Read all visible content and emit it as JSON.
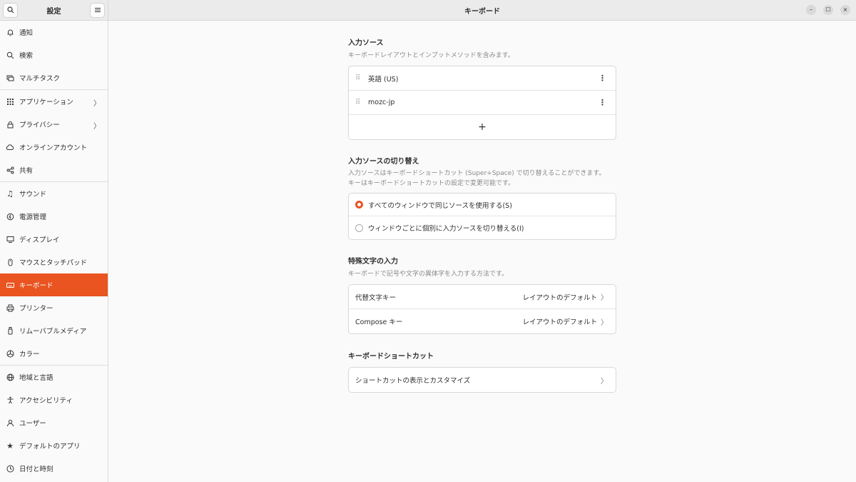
{
  "sidebar": {
    "title": "設定",
    "items": [
      {
        "label": "通知",
        "icon": "bell-icon",
        "glyph": "♫"
      },
      {
        "label": "検索",
        "icon": "search-icon"
      },
      {
        "label": "マルチタスク",
        "icon": "multitask-icon"
      },
      {
        "label": "アプリケーション",
        "icon": "apps-grid-icon"
      },
      {
        "label": "プライバシー",
        "icon": "lock-icon"
      },
      {
        "label": "オンラインアカウント",
        "icon": "cloud-icon"
      },
      {
        "label": "共有",
        "icon": "share-icon"
      },
      {
        "label": "サウンド",
        "icon": "music-note-icon"
      },
      {
        "label": "電源管理",
        "icon": "power-icon"
      },
      {
        "label": "ディスプレイ",
        "icon": "display-icon"
      },
      {
        "label": "マウスとタッチパッド",
        "icon": "mouse-icon"
      },
      {
        "label": "キーボード",
        "icon": "keyboard-icon"
      },
      {
        "label": "プリンター",
        "icon": "printer-icon"
      },
      {
        "label": "リムーバブルメディア",
        "icon": "usb-icon"
      },
      {
        "label": "カラー",
        "icon": "color-icon"
      },
      {
        "label": "地域と言語",
        "icon": "globe-icon"
      },
      {
        "label": "アクセシビリティ",
        "icon": "accessibility-icon"
      },
      {
        "label": "ユーザー",
        "icon": "user-icon"
      },
      {
        "label": "デフォルトのアプリ",
        "icon": "star-icon"
      },
      {
        "label": "日付と時刻",
        "icon": "clock-icon"
      }
    ],
    "active": "キーボード"
  },
  "header": {
    "title": "キーボード",
    "min": "–",
    "max": "☐",
    "close": "×"
  },
  "sections": {
    "input_sources": {
      "title": "入力ソース",
      "desc": "キーボードレイアウトとインプットメソッドを含みます。",
      "items": [
        "英語 (US)",
        "mozc-jp"
      ],
      "add": "+"
    },
    "switching": {
      "title": "入力ソースの切り替え",
      "desc1": "入力ソースはキーボードショートカット (Super+Space) で切り替えることができます。",
      "desc2": "キーはキーボードショートカットの設定で変更可能です。",
      "option1": "すべてのウィンドウで同じソースを使用する(S)",
      "option2": "ウィンドウごとに個別に入力ソースを切り替える(I)",
      "selected": 1
    },
    "special": {
      "title": "特殊文字の入力",
      "desc": "キーボードで記号や文字の異体字を入力する方法です。",
      "rows": [
        {
          "label": "代替文字キー",
          "value": "レイアウトのデフォルト"
        },
        {
          "label": "Compose キー",
          "value": "レイアウトのデフォルト"
        }
      ]
    },
    "shortcuts": {
      "title": "キーボードショートカット",
      "row": "ショートカットの表示とカスタマイズ"
    }
  },
  "colors": {
    "accent": "#e95420"
  }
}
